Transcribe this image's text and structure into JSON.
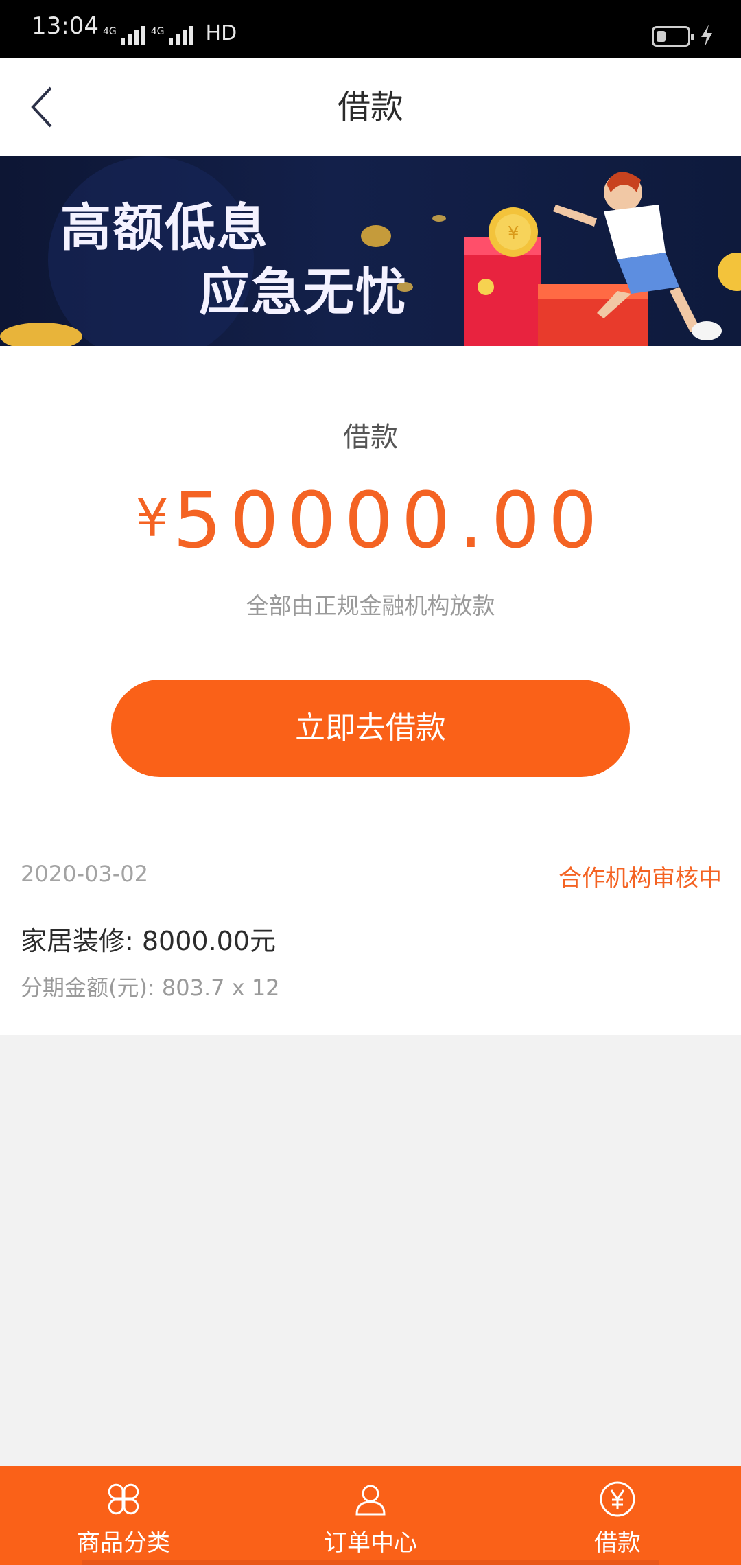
{
  "status_bar": {
    "time": "13:04",
    "network_1": "4G",
    "network_2": "4G",
    "hd": "HD",
    "battery_level": 0.3
  },
  "header": {
    "title": "借款",
    "back_icon": "chevron-left-icon"
  },
  "banner": {
    "line1": "高额低息",
    "line2": "应急无忧"
  },
  "loan": {
    "label": "借款",
    "currency": "¥",
    "amount": "50000.00",
    "note": "全部由正规金融机构放款",
    "button_label": "立即去借款"
  },
  "record": {
    "date": "2020-03-02",
    "status": "合作机构审核中",
    "title": "家居装修: 8000.00元",
    "installment": "分期金额(元): 803.7 x 12"
  },
  "tabs": [
    {
      "label": "商品分类",
      "icon": "category-icon"
    },
    {
      "label": "订单中心",
      "icon": "user-icon"
    },
    {
      "label": "借款",
      "icon": "yen-circle-icon"
    }
  ],
  "colors": {
    "accent": "#fa6118",
    "amount": "#f46323",
    "banner_bg": "#13204a"
  }
}
